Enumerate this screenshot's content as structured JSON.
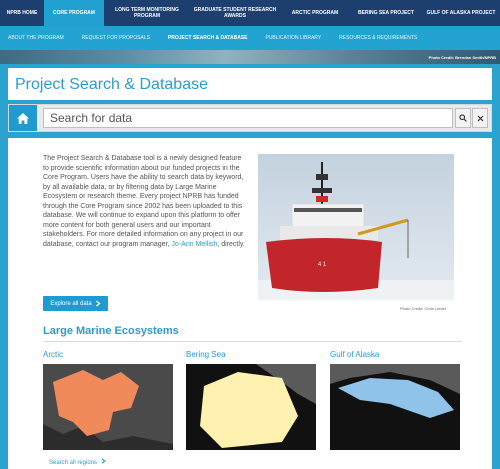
{
  "top_nav": [
    {
      "label": "NPRB HOME",
      "active": false
    },
    {
      "label": "CORE PROGRAM",
      "active": true
    },
    {
      "label": "LONG TERM MONITORING PROGRAM",
      "active": false
    },
    {
      "label": "GRADUATE STUDENT RESEARCH AWARDS",
      "active": false
    },
    {
      "label": "ARCTIC PROGRAM",
      "active": false
    },
    {
      "label": "BERING SEA PROJECT",
      "active": false
    },
    {
      "label": "GULF OF ALASKA PROJECT",
      "active": false
    }
  ],
  "sub_nav": [
    {
      "label": "About the Program",
      "active": false
    },
    {
      "label": "Request for Proposals",
      "active": false
    },
    {
      "label": "Project Search & Database",
      "active": true
    },
    {
      "label": "Publication Library",
      "active": false
    },
    {
      "label": "Resources & Requirements",
      "active": false
    }
  ],
  "banner_credit": "Photo Credit: Brendan Smith/NPRB",
  "page_title": "Project Search & Database",
  "search": {
    "placeholder": "Search for data",
    "value": ""
  },
  "icons": {
    "home": "home-icon",
    "search": "search-icon",
    "clear": "close-icon",
    "chevron": "chevron-right-icon"
  },
  "intro": {
    "text_before_link": "The Project Search & Database tool is a newly designed feature to provide scientific information about our funded projects in the Core Program. Users have the ability to search data by keyword, by all available data, or by filtering data by Large Marine Ecosystem or research theme. Every project NPRB has funded through the Core Program since 2002 has been uploaded to this database. We will continue to expand upon this platform to offer more content for both general users and our important stakeholders. For more detailed information on any project in our database, contact our program manager,",
    "link_text": "Jo-Ann Mellish",
    "text_after_link": ", directly."
  },
  "explore_button": "Explore all data",
  "photo_credit": "Photo Credit: Chris Linder",
  "lme_heading": "Large Marine Ecosystems",
  "regions": [
    {
      "name": "Arctic",
      "color": "#f08a5a"
    },
    {
      "name": "Bering Sea",
      "color": "#fff1b0"
    },
    {
      "name": "Gulf of Alaska",
      "color": "#8fc3ea"
    }
  ],
  "search_regions_link": "Search all regions",
  "colors": {
    "accent": "#2c9cd2",
    "navy": "#1d3f70",
    "teal": "#22a3d2"
  }
}
